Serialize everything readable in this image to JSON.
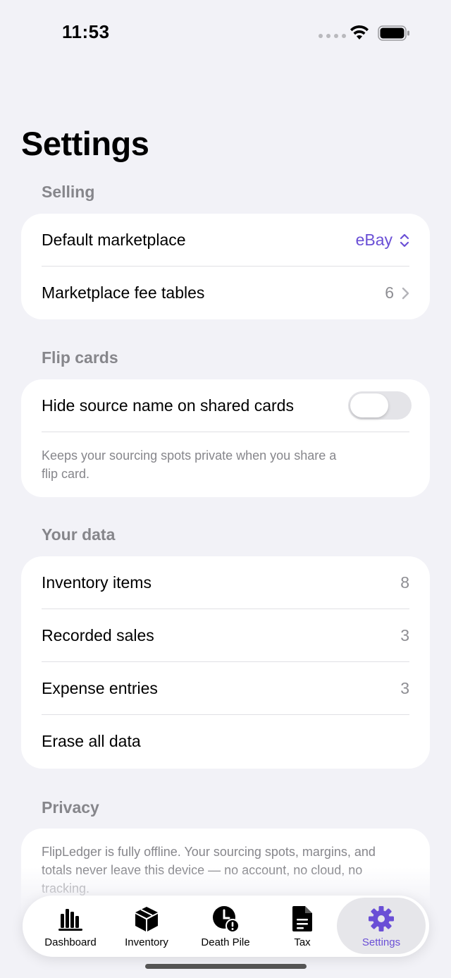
{
  "status": {
    "time": "11:53"
  },
  "page": {
    "title": "Settings"
  },
  "selling": {
    "header": "Selling",
    "default_marketplace": {
      "label": "Default marketplace",
      "value": "eBay"
    },
    "fee_tables": {
      "label": "Marketplace fee tables",
      "value": "6"
    }
  },
  "flip_cards": {
    "header": "Flip cards",
    "hide_source": {
      "label": "Hide source name on shared cards",
      "enabled": false
    },
    "footnote": "Keeps your sourcing spots private when you share a flip card."
  },
  "your_data": {
    "header": "Your data",
    "inventory_items": {
      "label": "Inventory items",
      "value": "8"
    },
    "recorded_sales": {
      "label": "Recorded sales",
      "value": "3"
    },
    "expense_entries": {
      "label": "Expense entries",
      "value": "3"
    },
    "erase": {
      "label": "Erase all data"
    }
  },
  "privacy": {
    "header": "Privacy",
    "text": "FlipLedger is fully offline. Your sourcing spots, margins, and totals never leave this device — no account, no cloud, no tracking."
  },
  "tabs": [
    {
      "label": "Dashboard",
      "icon": "bar-chart-icon"
    },
    {
      "label": "Inventory",
      "icon": "box-icon"
    },
    {
      "label": "Death Pile",
      "icon": "clock-alert-icon"
    },
    {
      "label": "Tax",
      "icon": "document-icon"
    },
    {
      "label": "Settings",
      "icon": "gear-icon",
      "active": true
    }
  ],
  "colors": {
    "accent": "#6a4fd6",
    "destructive": "#e5343a",
    "background": "#f2f2f7"
  }
}
